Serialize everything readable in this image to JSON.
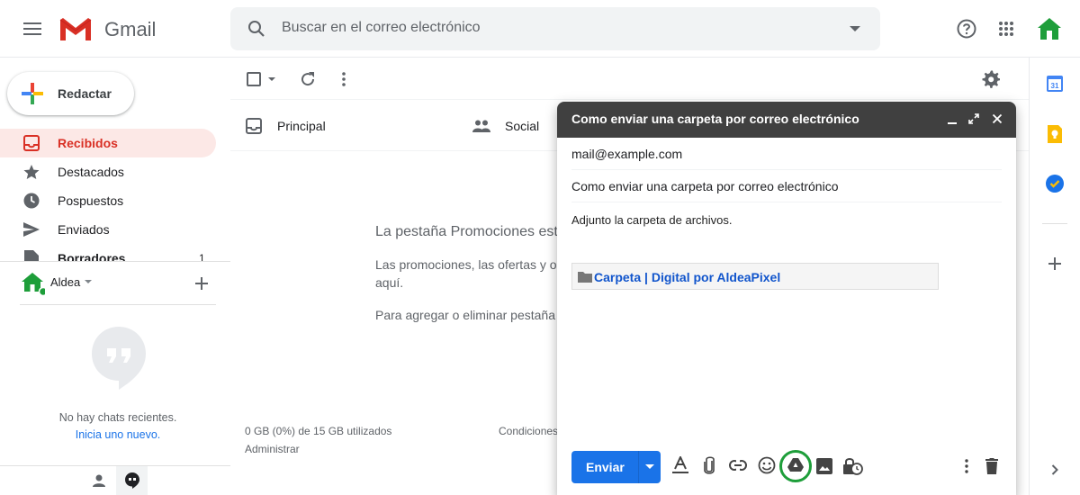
{
  "app": {
    "name": "Gmail"
  },
  "search": {
    "placeholder": "Buscar en el correo electrónico"
  },
  "sidebar": {
    "compose_label": "Redactar",
    "items": [
      {
        "label": "Recibidos",
        "icon": "inbox-icon",
        "active": true
      },
      {
        "label": "Destacados",
        "icon": "star-icon"
      },
      {
        "label": "Pospuestos",
        "icon": "clock-icon"
      },
      {
        "label": "Enviados",
        "icon": "send-icon"
      },
      {
        "label": "Borradores",
        "icon": "draft-icon",
        "count": "1"
      }
    ]
  },
  "hangouts": {
    "user_name": "Aldea",
    "no_chats": "No hay chats recientes.",
    "start_new": "Inicia uno nuevo."
  },
  "main": {
    "tabs": [
      {
        "label": "Principal",
        "icon": "inbox-tab-icon"
      },
      {
        "label": "Social",
        "icon": "people-icon"
      }
    ],
    "promo": {
      "heading": "La pestaña Promociones est",
      "line1": "Las promociones, las ofertas y o",
      "line2": "aquí.",
      "line3": "Para agregar o eliminar pestaña"
    },
    "footer": {
      "storage": "0 GB (0%) de 15 GB utilizados",
      "manage": "Administrar",
      "terms": "Condiciones"
    }
  },
  "compose": {
    "title": "Como enviar una carpeta por correo electrónico",
    "to": "mail@example.com",
    "subject": "Como enviar una carpeta por correo electrónico",
    "body": "Adjunto la carpeta de archivos.",
    "attachment_label": "Carpeta | Digital por AldeaPixel",
    "send_label": "Enviar"
  },
  "colors": {
    "accent": "#1a73e8",
    "gmail_red": "#d93025",
    "active_nav_bg": "#fce8e6",
    "compose_header": "#404040",
    "drive_highlight": "#1e9e3a"
  }
}
